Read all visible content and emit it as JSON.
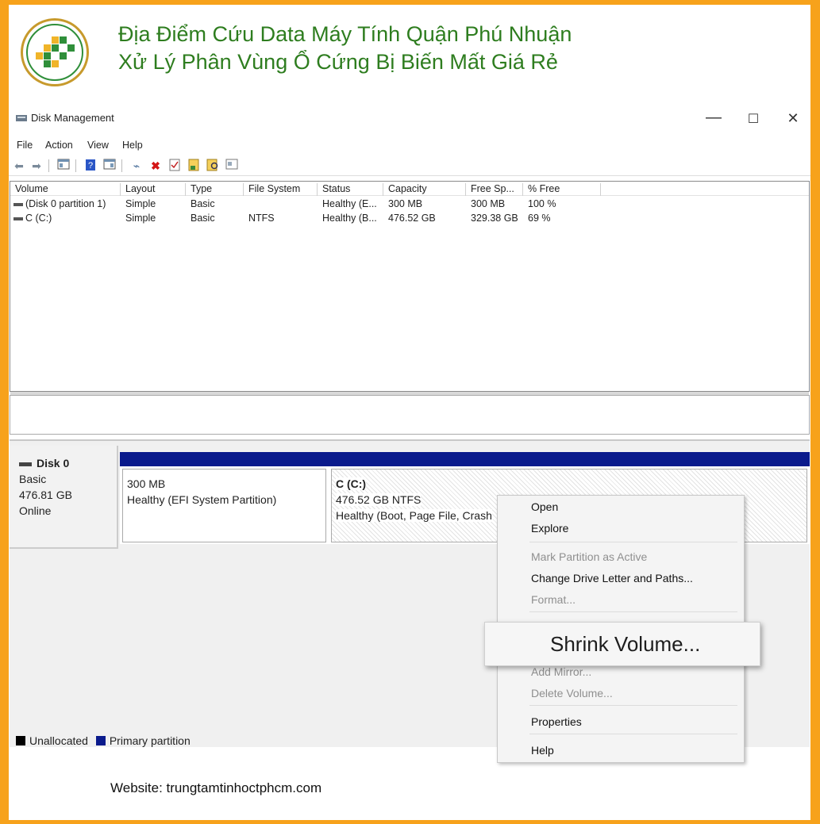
{
  "banner": {
    "title_line1": "Địa Điểm Cứu Data Máy Tính Quận Phú Nhuận",
    "title_line2": "Xử Lý Phân Vùng Ổ Cứng Bị Biến Mất Giá Rẻ",
    "brand_color": "#2e7d1f",
    "frame_color": "#f7a21b"
  },
  "window": {
    "title": "Disk Management",
    "controls": {
      "minimize": "—",
      "maximize": "☐",
      "close": "✕"
    },
    "menu": [
      "File",
      "Action",
      "View",
      "Help"
    ]
  },
  "toolbar": {
    "icons": [
      "back-arrow-icon",
      "forward-arrow-icon",
      "console-tree-icon",
      "help-icon",
      "properties-icon",
      "connect-icon",
      "delete-icon",
      "check-icon",
      "new-volume-icon",
      "search-icon",
      "view-icon"
    ]
  },
  "volume_table": {
    "columns": [
      "Volume",
      "Layout",
      "Type",
      "File System",
      "Status",
      "Capacity",
      "Free Sp...",
      "% Free"
    ],
    "rows": [
      {
        "volume": "(Disk 0 partition 1)",
        "layout": "Simple",
        "type": "Basic",
        "fs": "",
        "status": "Healthy (E...",
        "capacity": "300 MB",
        "free": "300 MB",
        "pct": "100 %"
      },
      {
        "volume": "C (C:)",
        "layout": "Simple",
        "type": "Basic",
        "fs": "NTFS",
        "status": "Healthy (B...",
        "capacity": "476.52 GB",
        "free": "329.38 GB",
        "pct": "69 %"
      }
    ]
  },
  "disk": {
    "name": "Disk 0",
    "type": "Basic",
    "size": "476.81 GB",
    "state": "Online",
    "partitions": [
      {
        "size": "300 MB",
        "status": "Healthy (EFI System Partition)"
      },
      {
        "name": "C  (C:)",
        "size": "476.52 GB NTFS",
        "status": "Healthy (Boot, Page File, Crash"
      }
    ],
    "bar_color": "#0a1a8c"
  },
  "legend": {
    "unallocated": "Unallocated",
    "primary": "Primary partition",
    "unallocated_color": "#000000",
    "primary_color": "#0a1a8c"
  },
  "context_menu": {
    "open": "Open",
    "explore": "Explore",
    "mark_active": "Mark Partition as Active",
    "change_letter": "Change Drive Letter and Paths...",
    "format": "Format...",
    "shrink": "Shrink Volume...",
    "add_mirror": "Add Mirror...",
    "delete": "Delete Volume...",
    "properties": "Properties",
    "help": "Help"
  },
  "footer": {
    "website": "Website: trungtamtinhoctphcm.com"
  }
}
